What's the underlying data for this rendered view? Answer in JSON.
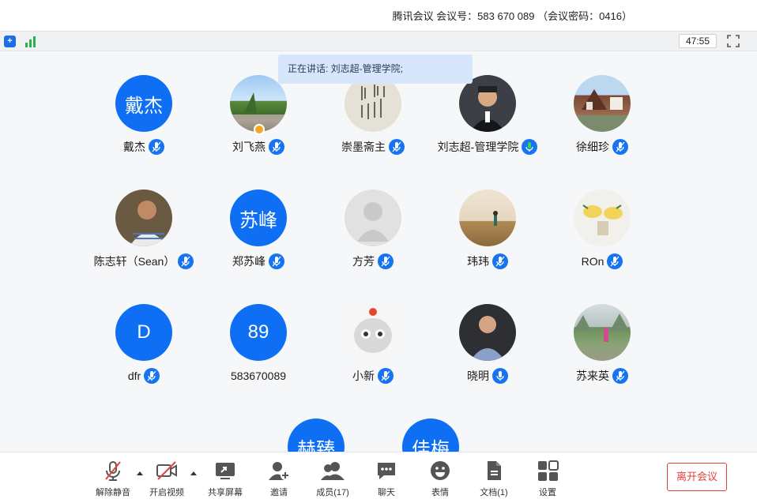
{
  "header": {
    "meeting_info": "腾讯会议 会议号：583 670 089 （会议密码：0416）",
    "timer": "47:55"
  },
  "speaking_banner": "正在讲话: 刘志超-管理学院;",
  "participants": [
    {
      "name": "戴杰",
      "avatar_text": "戴杰",
      "avatar_type": "initials"
    },
    {
      "name": "刘飞燕",
      "avatar_text": "",
      "avatar_type": "photo-park"
    },
    {
      "name": "崇墨斋主",
      "avatar_text": "",
      "avatar_type": "photo-calligraphy"
    },
    {
      "name": "刘志超-管理学院",
      "avatar_text": "",
      "avatar_type": "photo-portrait"
    },
    {
      "name": "徐细珍",
      "avatar_text": "",
      "avatar_type": "photo-house"
    },
    {
      "name": "陈志轩（Sean）",
      "avatar_text": "",
      "avatar_type": "photo-man"
    },
    {
      "name": "郑苏峰",
      "avatar_text": "苏峰",
      "avatar_type": "initials"
    },
    {
      "name": "方芳",
      "avatar_text": "",
      "avatar_type": "default"
    },
    {
      "name": "玮玮",
      "avatar_text": "",
      "avatar_type": "photo-field"
    },
    {
      "name": "ROn",
      "avatar_text": "",
      "avatar_type": "photo-illustration"
    },
    {
      "name": "dfr",
      "avatar_text": "D",
      "avatar_type": "initials"
    },
    {
      "name": "583670089",
      "avatar_text": "89",
      "avatar_type": "initials"
    },
    {
      "name": "小新",
      "avatar_text": "",
      "avatar_type": "photo-cat"
    },
    {
      "name": "晓明",
      "avatar_text": "",
      "avatar_type": "photo-man2"
    },
    {
      "name": "苏来英",
      "avatar_text": "",
      "avatar_type": "photo-lake"
    },
    {
      "name": "",
      "avatar_text": "赫臻",
      "avatar_type": "initials"
    },
    {
      "name": "",
      "avatar_text": "佳梅",
      "avatar_type": "initials"
    }
  ],
  "toolbar": {
    "unmute": "解除静音",
    "start_video": "开启视频",
    "share_screen": "共享屏幕",
    "invite": "邀请",
    "members": "成员(17)",
    "chat": "聊天",
    "emoji": "表情",
    "docs": "文档(1)",
    "settings": "设置",
    "leave": "离开会议"
  },
  "colors": {
    "accent": "#0e6ff5",
    "leave": "#e0433a",
    "banner": "#d7e6fb",
    "signal": "#27b24a"
  }
}
